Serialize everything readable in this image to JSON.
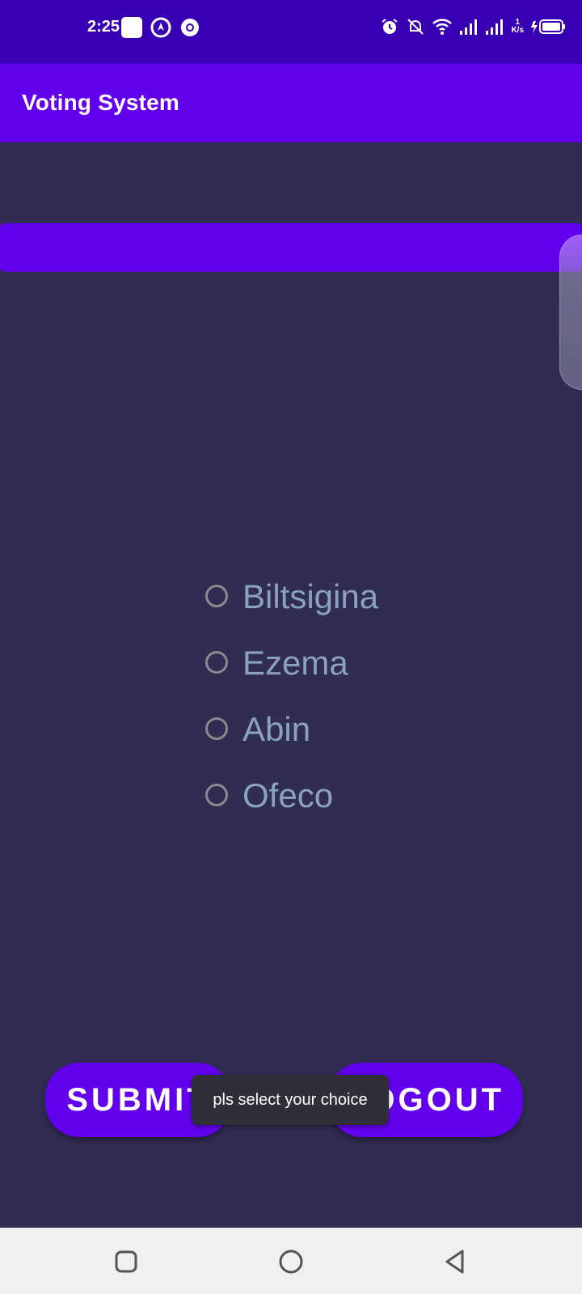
{
  "status_bar": {
    "time": "2:25",
    "left_icons": [
      "app-square-icon",
      "navigation-icon",
      "chrome-icon"
    ],
    "right_icons": [
      "alarm-icon",
      "mute-icon",
      "wifi-icon",
      "signal-icon",
      "signal-icon",
      "data-speed-icon",
      "battery-charging-icon"
    ],
    "data_speed_value": "1",
    "data_speed_unit": "K/s"
  },
  "app_bar": {
    "title": "Voting System"
  },
  "candidates": [
    {
      "label": "Biltsigina",
      "selected": false
    },
    {
      "label": "Ezema",
      "selected": false
    },
    {
      "label": "Abin",
      "selected": false
    },
    {
      "label": "Ofeco",
      "selected": false
    }
  ],
  "buttons": {
    "submit_label": "SUBMIT",
    "logout_label": "LOGOUT"
  },
  "toast": {
    "message": "pls select your choice"
  },
  "nav_bar": {
    "icons": [
      "recents-icon",
      "home-icon",
      "back-icon"
    ]
  },
  "colors": {
    "primary": "#6200ee",
    "status_bar": "#3700b3",
    "background": "#312c52",
    "radio_label": "#8aa1c0"
  }
}
